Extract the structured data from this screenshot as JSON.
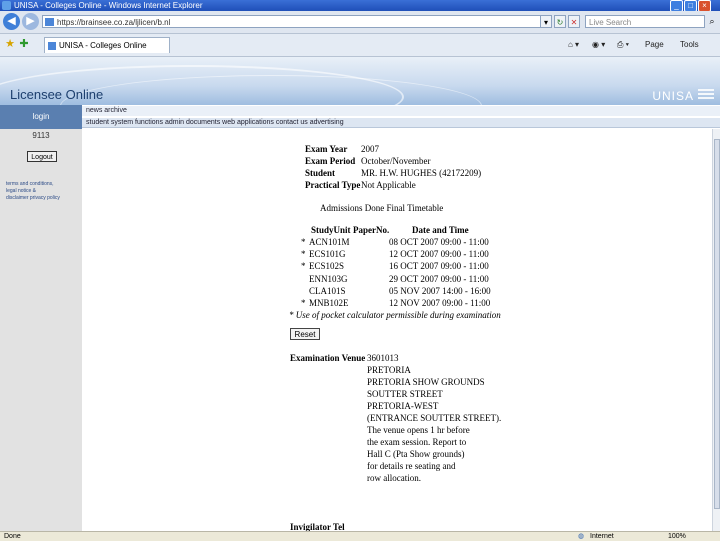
{
  "window": {
    "title": "UNISA - Colleges Online - Windows Internet Explorer",
    "address": "https://brainsee.co.za/ljlicen/b.nl",
    "search_placeholder": "Live Search",
    "tab_title": "UNISA - Colleges Online"
  },
  "toolbar": {
    "page_label": "Page",
    "tools_label": "Tools"
  },
  "banner": {
    "title": "Licensee Online",
    "logo": "UNISA"
  },
  "sidebar": {
    "header": "login",
    "id": "9113",
    "logout_label": "Logout",
    "links": [
      "terms and conditions,",
      "legal notice &",
      "disclaimer privacy policy"
    ]
  },
  "nav": {
    "row1": "news archive",
    "row2": "student system functions   admin documents   web applications   contact us   advertising"
  },
  "exam": {
    "year_label": "Exam Year",
    "year": "2007",
    "period_label": "Exam Period",
    "period": "October/November",
    "student_label": "Student",
    "student": "MR. H.W. HUGHES  (42172209)",
    "practical_label": "Practical Type",
    "practical": "Not Applicable",
    "admissions": "Admissions Done    Final Timetable",
    "col_study": "StudyUnit",
    "col_paper": "PaperNo.",
    "col_date": "Date and Time",
    "rows": [
      {
        "mark": "*",
        "unit": "ACN101M",
        "date": "08 OCT 2007 09:00 - 11:00"
      },
      {
        "mark": "*",
        "unit": "ECS101G",
        "date": "12 OCT 2007 09:00 - 11:00"
      },
      {
        "mark": "*",
        "unit": "ECS102S",
        "date": "16 OCT 2007 09:00 - 11:00"
      },
      {
        "mark": "",
        "unit": "ENN103G",
        "date": "29 OCT 2007 09:00 - 11:00"
      },
      {
        "mark": "",
        "unit": "CLA101S",
        "date": "05 NOV 2007 14:00 - 16:00"
      },
      {
        "mark": "*",
        "unit": "MNB102E",
        "date": "12 NOV 2007 09:00 - 11:00"
      }
    ],
    "footnote": "* Use of pocket calculator permissible during examination",
    "reset_label": "Reset",
    "venue_label": "Examination Venue",
    "venue_code": "3601013",
    "venue_lines": [
      "PRETORIA",
      "PRETORIA SHOW GROUNDS",
      "SOUTTER STREET",
      "PRETORIA-WEST",
      "(ENTRANCE SOUTTER STREET).",
      "The venue opens 1 hr before",
      "the exam session. Report to",
      "Hall C (Pta Show grounds)",
      "for details re seating and",
      "row allocation."
    ],
    "invigilator_label": "Invigilator    Tel"
  },
  "status": {
    "left": "Done",
    "zone": "Internet",
    "zoom": "100%"
  }
}
